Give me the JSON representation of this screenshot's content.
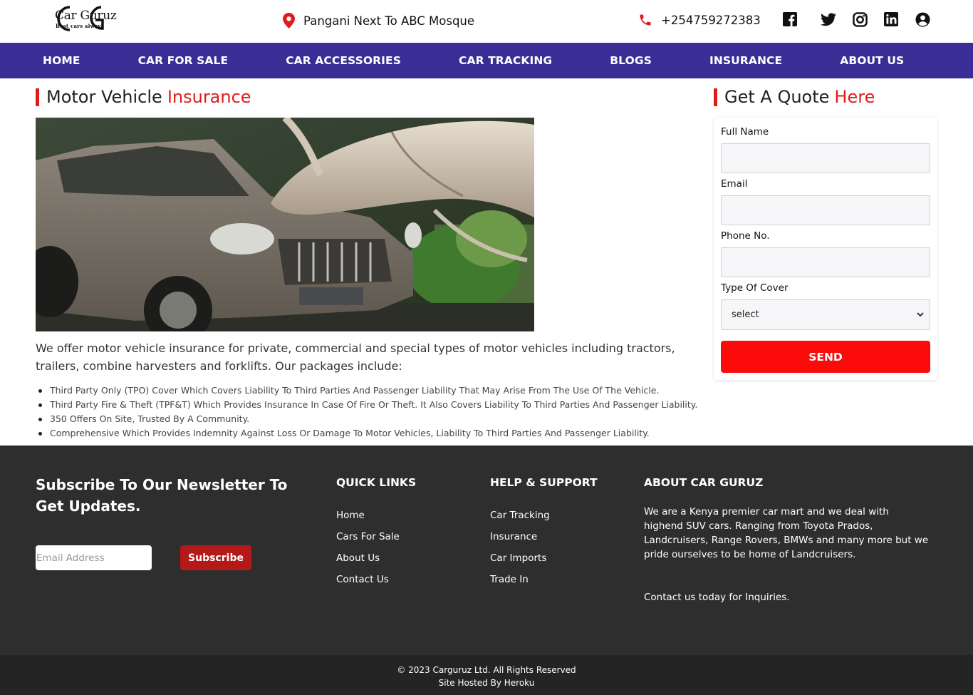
{
  "header": {
    "logo_text": "Car Guruz",
    "logo_tagline": "Best cars always",
    "location": "Pangani Next To ABC Mosque",
    "phone": "+254759272383",
    "social_icons": [
      "facebook-icon",
      "twitter-icon",
      "instagram-icon",
      "linkedin-icon",
      "account-icon"
    ]
  },
  "nav": {
    "items": [
      {
        "label": "HOME"
      },
      {
        "label": "CAR FOR SALE"
      },
      {
        "label": "CAR ACCESSORIES"
      },
      {
        "label": "CAR TRACKING"
      },
      {
        "label": "BLOGS"
      },
      {
        "label": "INSURANCE"
      },
      {
        "label": "ABOUT US"
      }
    ]
  },
  "main": {
    "title": "Motor Vehicle",
    "title_accent": "Insurance",
    "intro": "We offer motor vehicle insurance for private, commercial and special types of motor vehicles including tractors, trailers, combine harvesters and forklifts. Our packages include:",
    "packages": [
      "Third Party Only (TPO) Cover Which Covers Liability To Third Parties And Passenger Liability That May Arise From The Use Of The Vehicle.",
      "Third Party Fire & Theft (TPF&T) Which Provides Insurance In Case Of Fire Or Theft. It Also Covers Liability To Third Parties And Passenger Liability.",
      "350 Offers On Site, Trusted By A Community.",
      "Comprehensive Which Provides Indemnity Against Loss Or Damage To Motor Vehicles, Liability To Third Parties And Passenger Liability."
    ]
  },
  "quote": {
    "title": "Get A Quote",
    "title_accent": "Here",
    "full_name_label": "Full Name",
    "full_name_value": "",
    "email_label": "Email",
    "email_value": "",
    "phone_label": "Phone No.",
    "phone_value": "",
    "cover_label": "Type Of Cover",
    "cover_selected": "select",
    "send_label": "SEND"
  },
  "footer": {
    "newsletter_title": "Subscribe To Our Newsletter To Get Updates.",
    "email_placeholder": "Email Address",
    "subscribe_label": "Subscribe",
    "quick_links": {
      "heading": "QUICK LINKS",
      "items": [
        "Home",
        "Cars For Sale",
        "About Us",
        "Contact Us"
      ]
    },
    "help": {
      "heading": "HELP & SUPPORT",
      "items": [
        "Car Tracking",
        "Insurance",
        "Car Imports",
        "Trade In"
      ]
    },
    "about": {
      "heading": "ABOUT CAR GURUZ",
      "text": "We are a Kenya premier car mart and we deal with highend SUV cars. Ranging from Toyota Prados, Landcruisers, Range Rovers, BMWs and many more but we pride ourselves to be home of Landcruisers.",
      "contact": "Contact us today for Inquiries."
    },
    "copyright": "© 2023 Carguruz Ltd. All Rights Reserved",
    "hosted": "Site Hosted By Heroku"
  },
  "colors": {
    "nav_bg": "#3a2e96",
    "accent_red": "#e01b1b",
    "send_button": "#fd0b0b",
    "subscribe_button": "#b51818",
    "footer_bg": "#2e2e2e"
  }
}
